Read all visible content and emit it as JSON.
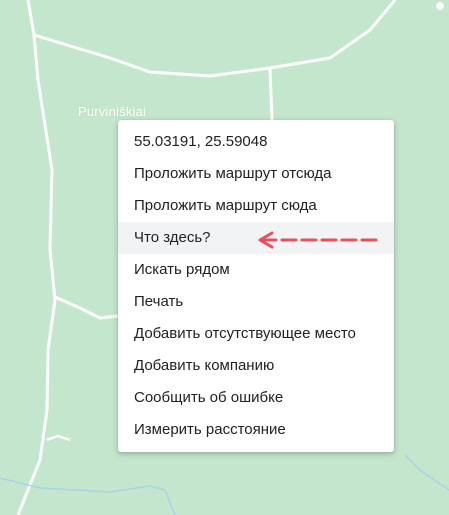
{
  "map": {
    "place_label": "Purviniškiai",
    "colors": {
      "land": "#c4e6cc",
      "road": "#ffffff",
      "water": "#a8d2ea"
    }
  },
  "context_menu": {
    "coordinates": "55.03191, 25.59048",
    "items": [
      {
        "label": "Проложить маршрут отсюда"
      },
      {
        "label": "Проложить маршрут сюда"
      },
      {
        "label": "Что здесь?",
        "highlighted": true
      },
      {
        "label": "Искать рядом"
      },
      {
        "label": "Печать"
      },
      {
        "label": "Добавить отсутствующее место"
      },
      {
        "label": "Добавить компанию"
      },
      {
        "label": "Сообщить об ошибке"
      },
      {
        "label": "Измерить расстояние"
      }
    ]
  },
  "annotation": {
    "arrow_color": "#e8505b",
    "icon": "dashed-left-arrow-icon"
  }
}
